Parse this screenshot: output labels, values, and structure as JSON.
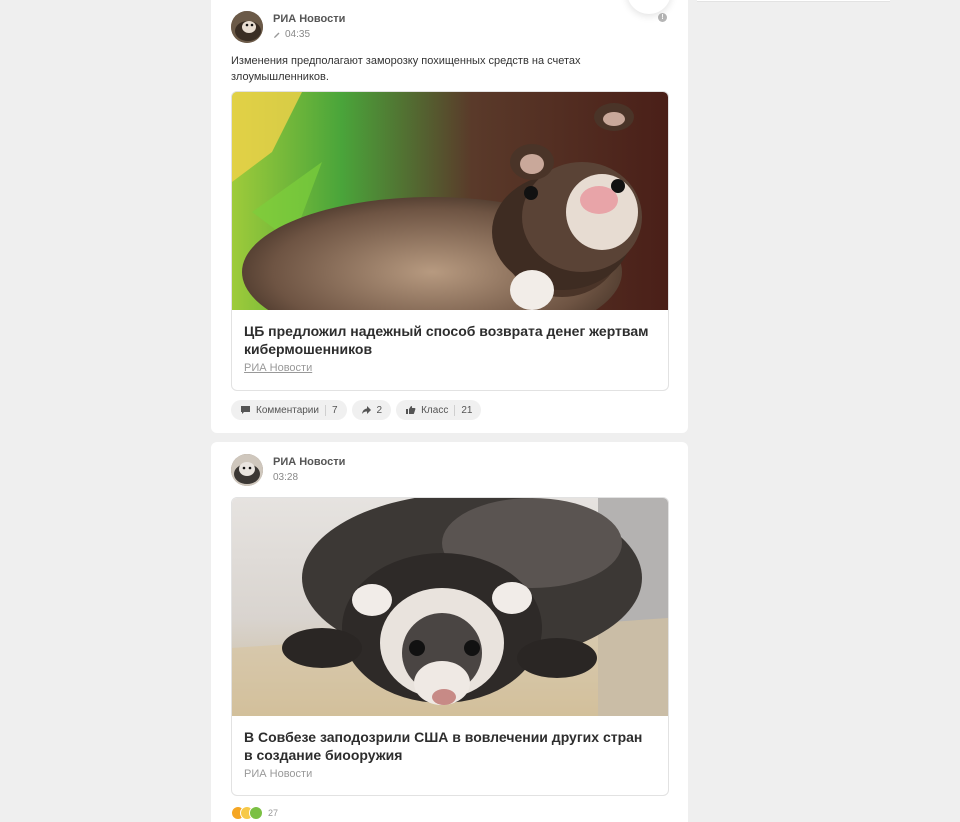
{
  "feed": {
    "posts": [
      {
        "author": "РИА Новости",
        "time": "04:35",
        "text": "Изменения предполагают заморозку похищенных средств на счетах злоумышленников.",
        "card": {
          "title": "ЦБ предложил надежный способ возврата денег жертвам кибермошенников",
          "source": "РИА Новости"
        },
        "actions": {
          "comments_label": "Комментарии",
          "comments_count": "7",
          "shares_count": "2",
          "likes_label": "Класс",
          "likes_count": "21"
        }
      },
      {
        "author": "РИА Новости",
        "time": "03:28",
        "card": {
          "title": "В Совбезе заподозрили США в вовлечении других стран в создание биооружия",
          "source": "РИА Новости"
        },
        "reactions_count": "27"
      }
    ]
  },
  "colors": {
    "page_background": "#efefef",
    "card_background": "#ffffff",
    "reaction_like": "#f5a623",
    "reaction_laugh": "#f7c948",
    "reaction_wow": "#7bc043"
  }
}
